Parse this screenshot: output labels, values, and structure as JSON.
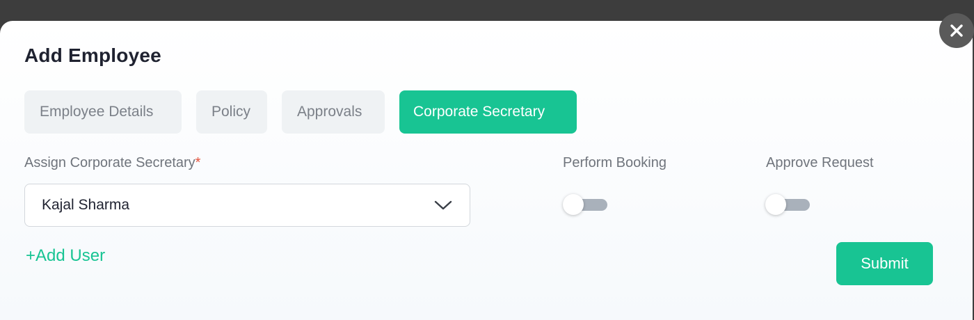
{
  "modal": {
    "title": "Add Employee",
    "close_icon": "close-icon"
  },
  "tabs": [
    {
      "label": "Employee Details",
      "active": false
    },
    {
      "label": "Policy",
      "active": false
    },
    {
      "label": "Approvals",
      "active": false
    },
    {
      "label": "Corporate Secretary",
      "active": true
    }
  ],
  "form": {
    "assign_label": "Assign Corporate Secretary",
    "required_marker": "*",
    "assign_value": "Kajal Sharma",
    "perform_booking_label": "Perform Booking",
    "perform_booking_on": false,
    "approve_request_label": "Approve Request",
    "approve_request_on": false,
    "add_user_label": "+Add User",
    "submit_label": "Submit"
  },
  "colors": {
    "accent": "#18c493",
    "backdrop": "#3d3d3d",
    "required": "#e5533d"
  }
}
